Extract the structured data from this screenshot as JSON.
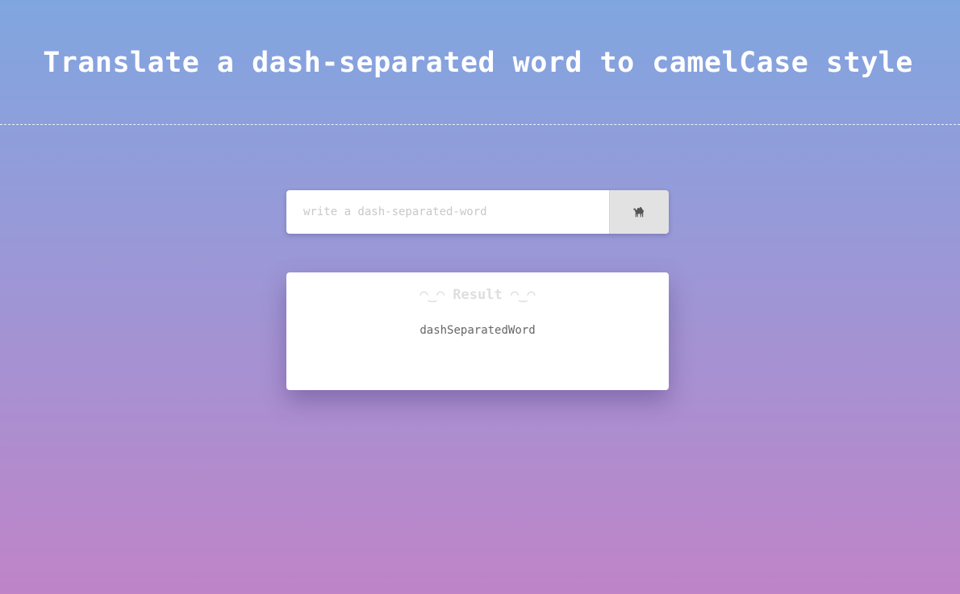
{
  "header": {
    "title": "Translate a dash-separated word to camelCase style"
  },
  "form": {
    "input_placeholder": "write a dash-separated-word",
    "input_value": "",
    "button_icon": "camel-icon"
  },
  "result": {
    "heading": "◠‿◠ Result ◠‿◠",
    "value": "dashSeparatedWord"
  },
  "colors": {
    "gradient_top": "#80a6e0",
    "gradient_bottom": "#bf84c8",
    "button_bg": "#e2e2e2",
    "heading_text": "#dedede"
  }
}
